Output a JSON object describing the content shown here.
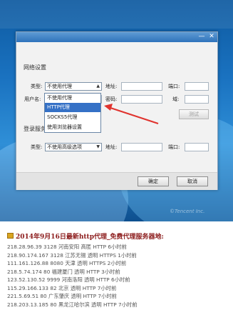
{
  "dialog": {
    "section_network": "网络设置",
    "section_login": "登录服务器",
    "type_label": "类型:",
    "address_label": "地址:",
    "port_label": "端口:",
    "username_label": "用户名:",
    "password_label": "密码:",
    "domain_label": "域:",
    "test_button": "测试",
    "proxy_type_value": "不使用代理",
    "login_type_value": "不使用高级选项",
    "ok_button": "确定",
    "cancel_button": "取消",
    "minimize_glyph": "—",
    "close_glyph": "✕"
  },
  "dropdown": {
    "options": [
      "不使用代理",
      "HTTP代理",
      "SOCKS5代理",
      "使用浏览器设置"
    ],
    "selected_index": 1
  },
  "watermark": "©Tencent Inc.",
  "article": {
    "title": "2014年9月16日最新http代理_免费代理服务器地:",
    "rows": [
      "218.28.96.39 3128 河南安阳 高匿 HTTP 6小时前",
      "218.90.174.167 3128 江苏无锡 透明 HTTPS 1小时前",
      "111.161.126.88 8080 天津 透明 HTTPS 2小时前",
      "218.5.74.174 80 福建厦门 透明 HTTP 3小时前",
      "123.52.130.52 9999 河南洛阳 透明 HTTP 6小时前",
      "115.29.166.133 82 北京 透明 HTTP 7小时前",
      "221.5.69.51 80 广东肇庆 透明 HTTP 7小时前",
      "218.203.13.185 80 黑龙江哈尔滨 透明 HTTP 7小时前"
    ]
  },
  "colors": {
    "selection": "#3571c6",
    "arrow": "#e0332e",
    "title": "#8b1a1a"
  }
}
